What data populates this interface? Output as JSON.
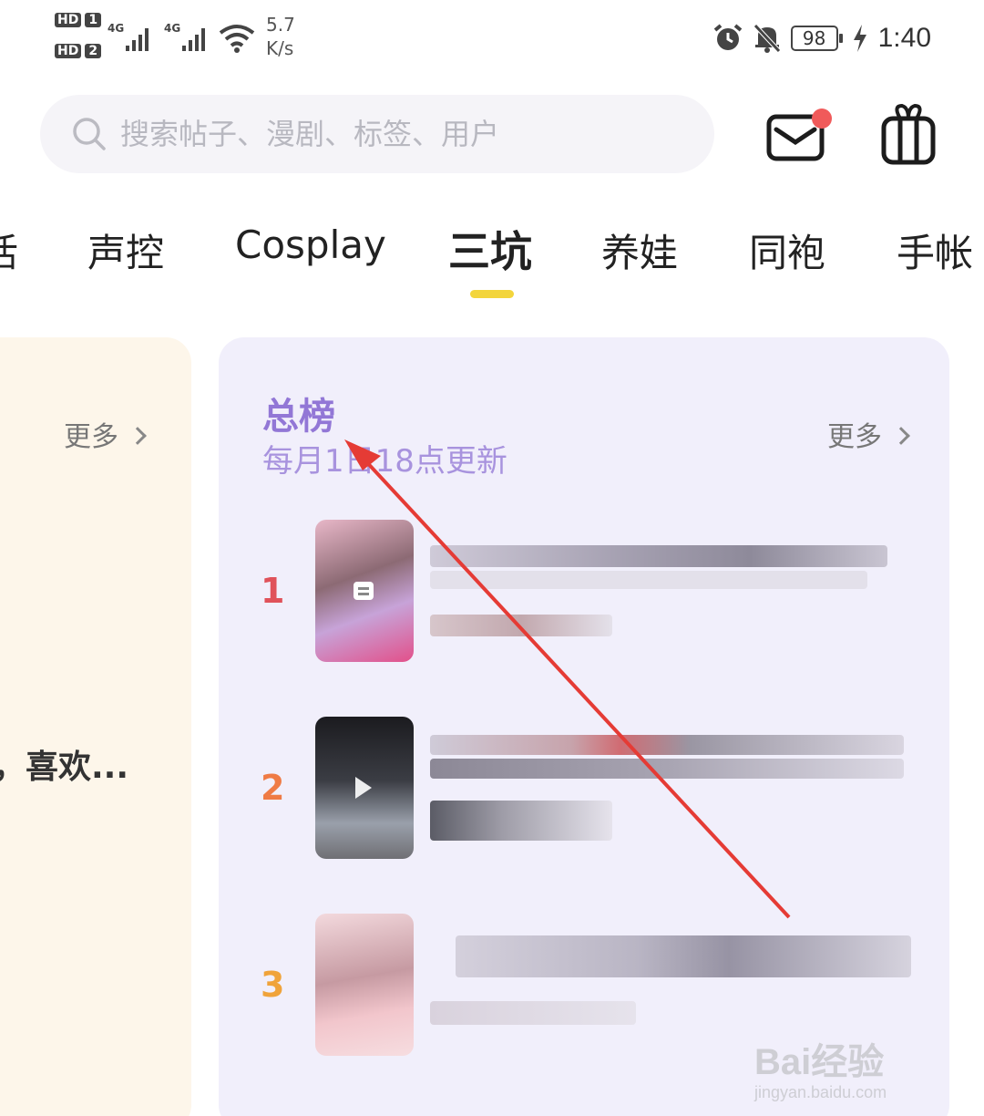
{
  "status_bar": {
    "sim1": "HD",
    "sim1_num": "1",
    "sim2": "HD",
    "sim2_num": "2",
    "net1": "4G",
    "net2": "4G",
    "speed_value": "5.7",
    "speed_unit": "K/s",
    "battery": "98",
    "time": "1:40"
  },
  "search": {
    "placeholder": "搜索帖子、漫剧、标签、用户"
  },
  "header": {
    "mail_icon": "mail-icon",
    "gift_icon": "gift-icon",
    "notification_color": "#f05a5a"
  },
  "tabs": [
    {
      "label": "活"
    },
    {
      "label": "声控"
    },
    {
      "label": "Cosplay"
    },
    {
      "label": "三坑",
      "active": true
    },
    {
      "label": "养娃"
    },
    {
      "label": "同袍"
    },
    {
      "label": "手帐"
    }
  ],
  "left_card": {
    "more_label": "更多",
    "snippet": "，喜欢..."
  },
  "ranking": {
    "title": "总榜",
    "subtitle": "每月1日18点更新",
    "more_label": "更多",
    "items": [
      {
        "rank": "1",
        "color": "#e0525a"
      },
      {
        "rank": "2",
        "color": "#ef7b45"
      },
      {
        "rank": "3",
        "color": "#f0a33a"
      }
    ]
  },
  "watermark": {
    "main": "Bai经验",
    "sub": "jingyan.baidu.com"
  },
  "colors": {
    "accent_purple": "#9277d6",
    "tab_underline": "#f3d53c",
    "annotation_arrow": "#e53b35"
  }
}
